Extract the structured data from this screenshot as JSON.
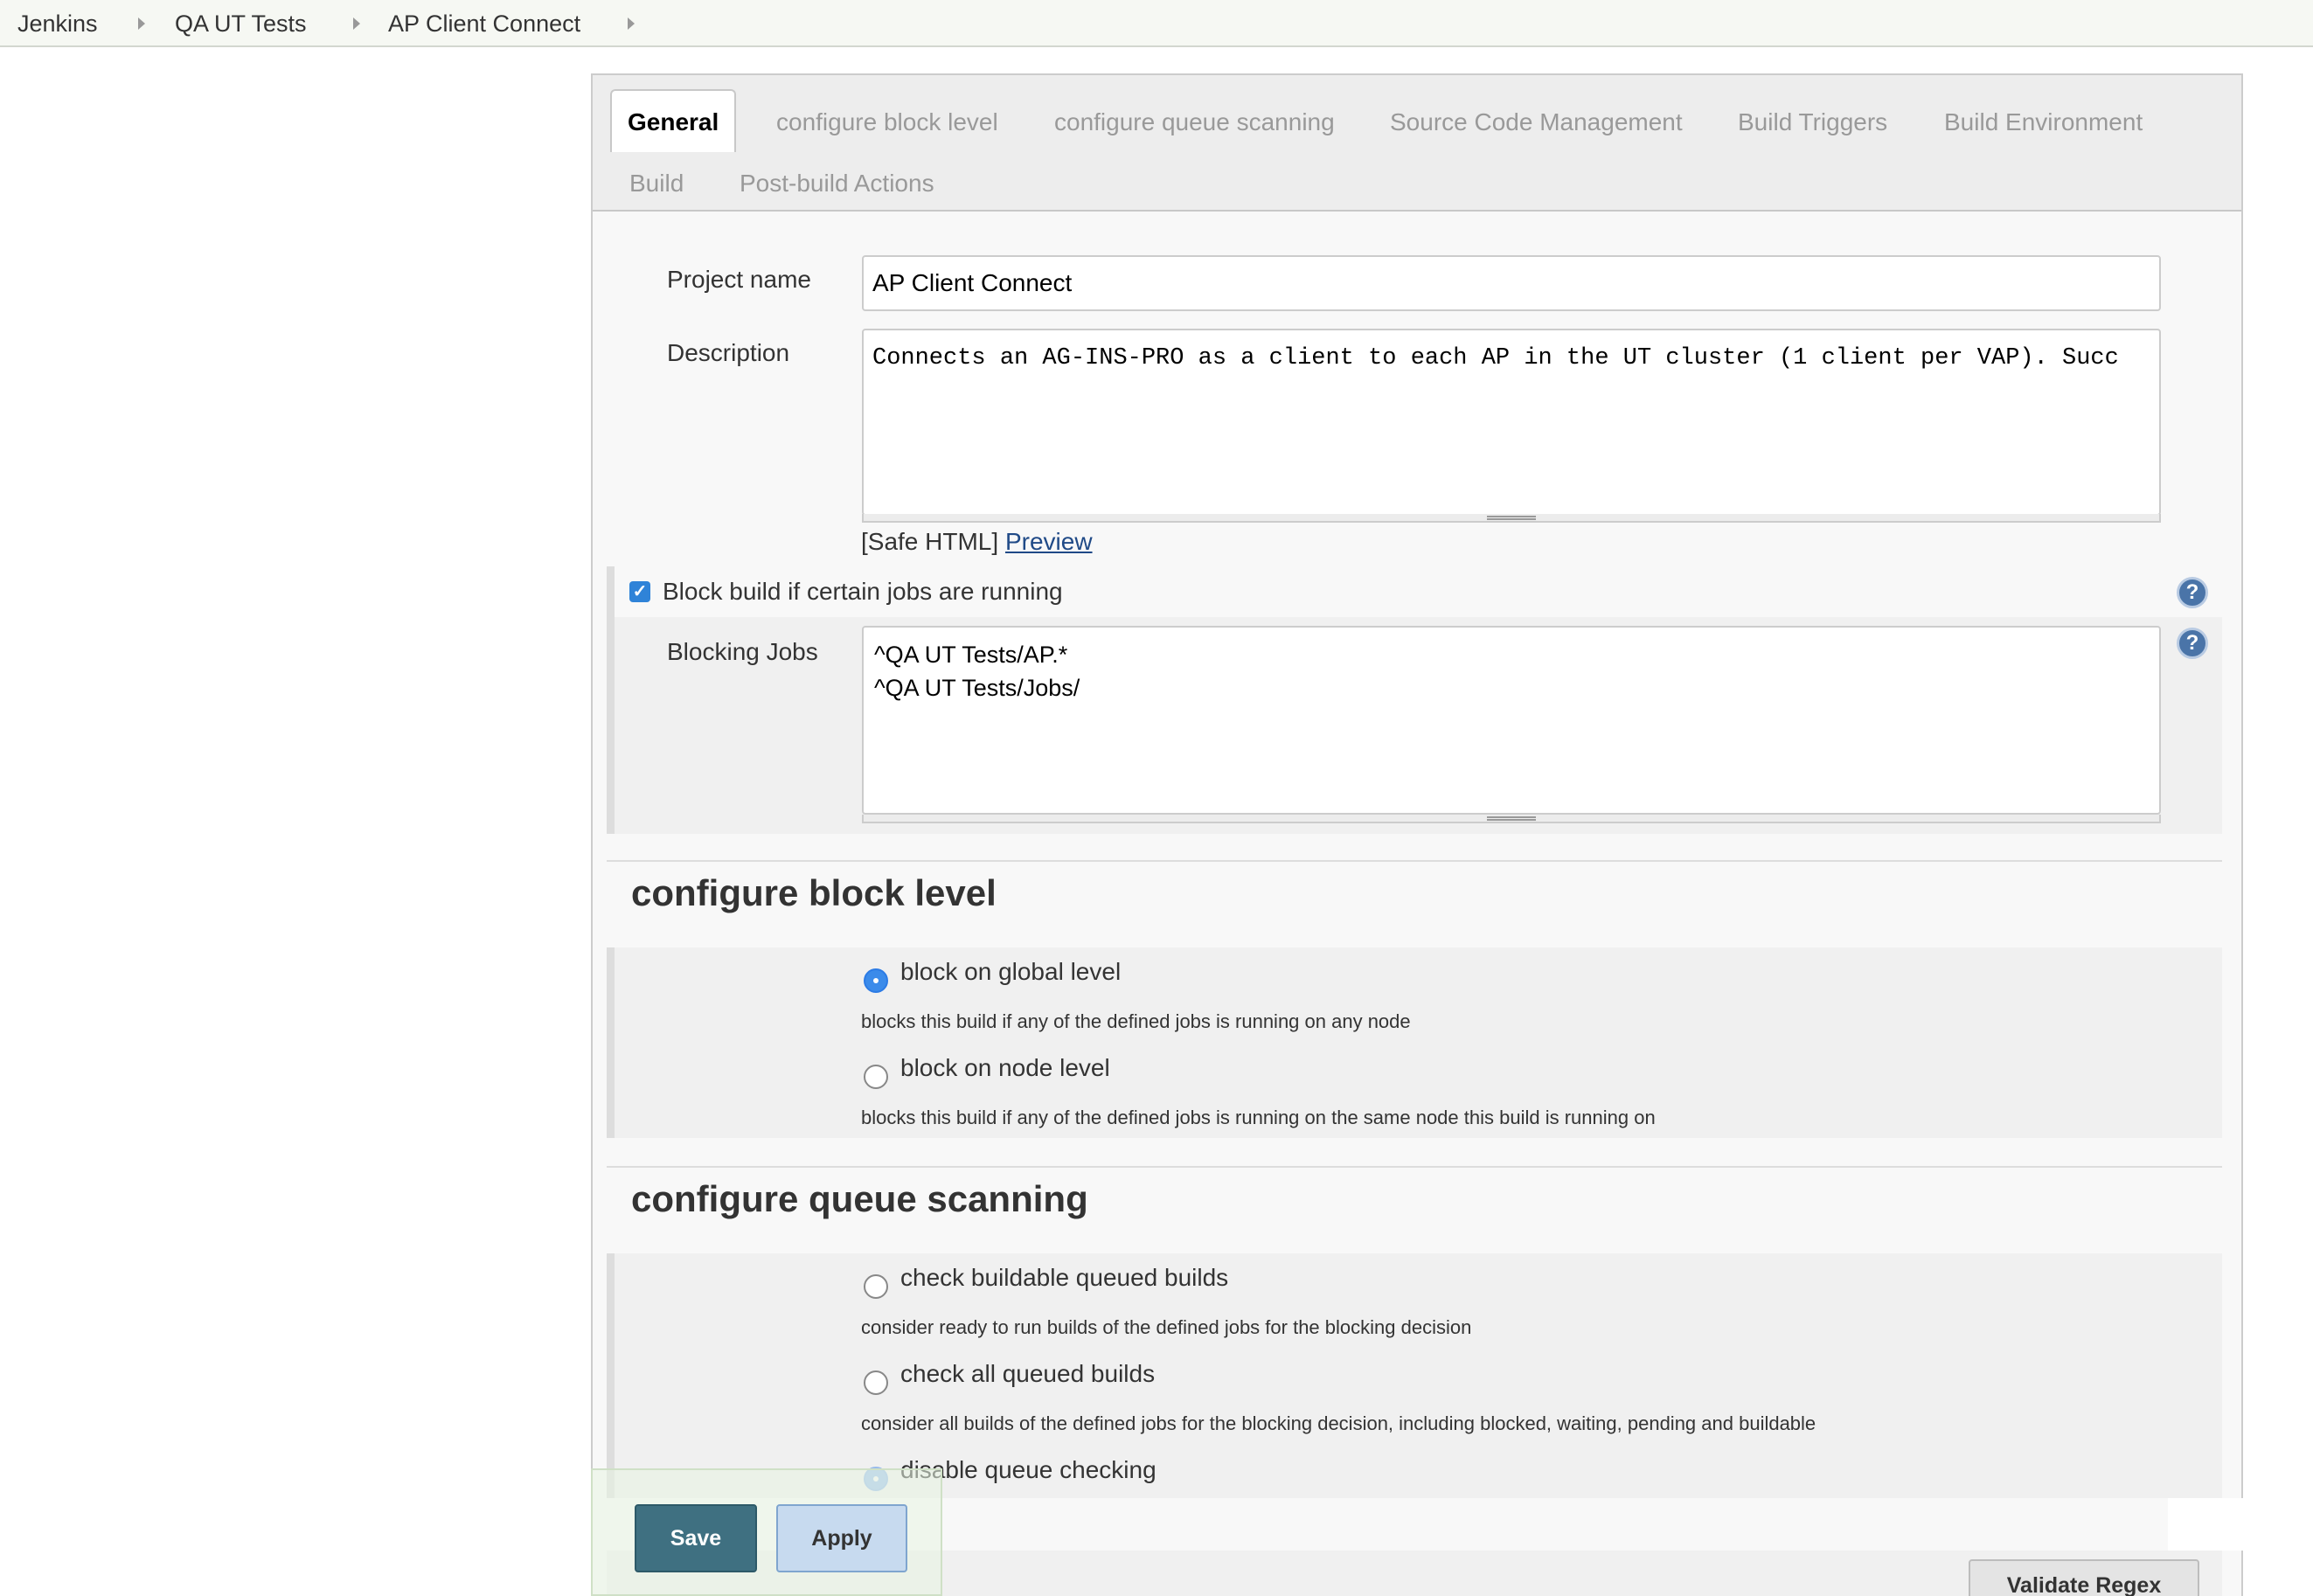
{
  "breadcrumb": {
    "items": [
      "Jenkins",
      "QA UT Tests",
      "AP Client Connect"
    ]
  },
  "tabs": [
    {
      "label": "General",
      "active": true
    },
    {
      "label": "configure block level",
      "active": false
    },
    {
      "label": "configure queue scanning",
      "active": false
    },
    {
      "label": "Source Code Management",
      "active": false
    },
    {
      "label": "Build Triggers",
      "active": false
    },
    {
      "label": "Build Environment",
      "active": false
    },
    {
      "label": "Build",
      "active": false
    },
    {
      "label": "Post-build Actions",
      "active": false
    }
  ],
  "general": {
    "project_name_label": "Project name",
    "project_name_value": "AP Client Connect",
    "description_label": "Description",
    "description_value": "Connects an AG-INS-PRO as a client to each AP in the UT cluster (1 client per VAP). Succ",
    "safe_html_label": "[Safe HTML]",
    "preview_link": "Preview",
    "block_build_label": "Block build if certain jobs are running",
    "block_build_checked": true,
    "blocking_jobs_label": "Blocking Jobs",
    "blocking_jobs_value": "^QA UT Tests/AP.*\n^QA UT Tests/Jobs/"
  },
  "block_level": {
    "title": "configure block level",
    "options": [
      {
        "label": "block on global level",
        "description": "blocks this build if any of the defined jobs is running on any node",
        "selected": true
      },
      {
        "label": "block on node level",
        "description": "blocks this build if any of the defined jobs is running on the same node this build is running on",
        "selected": false
      }
    ]
  },
  "queue_scanning": {
    "title": "configure queue scanning",
    "options": [
      {
        "label": "check buildable queued builds",
        "description": "consider ready to run builds of the defined jobs for the blocking decision",
        "selected": false
      },
      {
        "label": "check all queued builds",
        "description": "consider all builds of the defined jobs for the blocking decision, including blocked, waiting, pending and buildable",
        "selected": false
      },
      {
        "label": "disable queue checking",
        "description": "",
        "selected": true
      }
    ]
  },
  "actions": {
    "save_label": "Save",
    "apply_label": "Apply",
    "validate_label": "Validate Regex"
  },
  "icons": {
    "help": "help-question-icon",
    "check": "checkmark-icon",
    "breadcrumb_separator": "caret-right-icon"
  },
  "colors": {
    "accent_blue": "#2f83d8",
    "save_button": "#3f7081",
    "apply_button": "#c7daef",
    "link": "#204a87"
  }
}
